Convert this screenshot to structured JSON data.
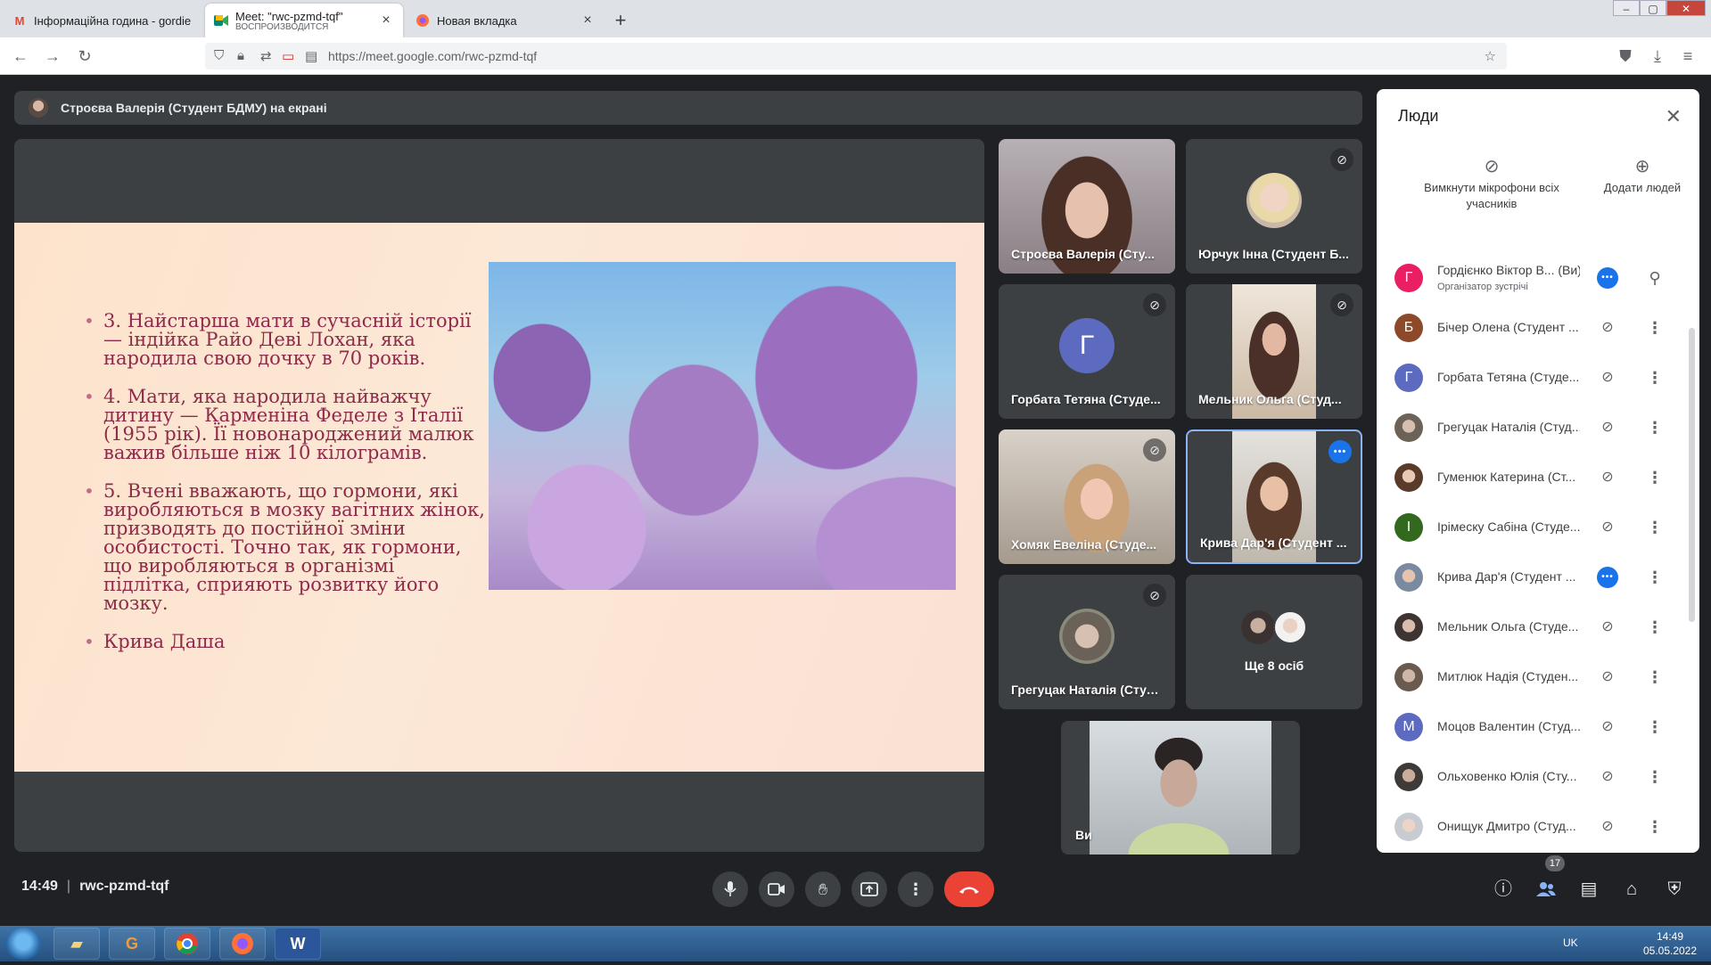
{
  "browser": {
    "tabs": [
      {
        "title": "Інформаційна година - gordie",
        "sub": ""
      },
      {
        "title": "Meet: \"rwc-pzmd-tqf\"",
        "sub": "ВОСПРОИЗВОДИТСЯ"
      },
      {
        "title": "Новая вкладка",
        "sub": ""
      }
    ],
    "url": "https://meet.google.com/rwc-pzmd-tqf"
  },
  "presenting": {
    "text": "Строєва Валерія (Студент БДМУ) на екрані"
  },
  "slide": {
    "items": [
      "3. Найстарша мати в сучасній історії — індійка Райо Деві Лохан, яка народила свою дочку в 70 років.",
      "4. Мати, яка народила найважчу дитину — Карменіна Феделе з Італії (1955 рік). Її новонароджений малюк важив більше ніж 10 кілограмів.",
      "5. Вчені вважають, що гормони, які виробляються в мозку вагітних жінок, призводять до постійної зміни особистості. Точно так, як гормони, що виробляються в організмі підлітка, сприяють розвитку його мозку.",
      "Крива Даша"
    ]
  },
  "tiles": [
    {
      "name": "Строєва Валерія (Сту..."
    },
    {
      "name": "Юрчук Інна (Студент Б..."
    },
    {
      "name": "Горбата Тетяна (Студе...",
      "letter": "Г"
    },
    {
      "name": "Мельник Ольга (Студ..."
    },
    {
      "name": "Хомяк Евеліна (Студе..."
    },
    {
      "name": "Крива Дар'я (Студент ..."
    },
    {
      "name": "Грегуцак Наталія (Студ..."
    },
    {
      "name": "Ще 8 осіб"
    },
    {
      "name": "Ви"
    }
  ],
  "bottom": {
    "time": "14:49",
    "code": "rwc-pzmd-tqf",
    "people_count": "17"
  },
  "panel": {
    "title": "Люди",
    "mute_all": "Вимкнути мікрофони всіх учасників",
    "add_people": "Додати людей",
    "participants": [
      {
        "name": "Гордієнко Віктор В... (Ви)",
        "sub": "Організатор зустрічі",
        "letter": "Г",
        "color": "#e91e63"
      },
      {
        "name": "Бічер Олена (Студент ...",
        "letter": "Б",
        "color": "#8d4a2a"
      },
      {
        "name": "Горбата Тетяна (Студе...",
        "letter": "Г",
        "color": "#5c6bc0"
      },
      {
        "name": "Грегуцак Наталія (Студ...",
        "letter": "",
        "color": "#6d6258"
      },
      {
        "name": "Гуменюк Катерина (Ст...",
        "letter": "",
        "color": "#8a6a4e"
      },
      {
        "name": "Ірімеску Сабіна (Студе...",
        "letter": "І",
        "color": "#33691e"
      },
      {
        "name": "Крива Дар'я (Студент ...",
        "letter": "",
        "color": "#7a8aa0"
      },
      {
        "name": "Мельник Ольга (Студе...",
        "letter": "",
        "color": "#4a4040"
      },
      {
        "name": "Митлюк Надія (Студен...",
        "letter": "",
        "color": "#6a5a50"
      },
      {
        "name": "Моцов Валентин (Студ...",
        "letter": "М",
        "color": "#5c6bc0"
      },
      {
        "name": "Ольховенко Юлія (Сту...",
        "letter": "",
        "color": "#3e3a38"
      },
      {
        "name": "Онищук Дмитро (Студ...",
        "letter": "",
        "color": "#c8ccd2"
      }
    ]
  },
  "taskbar": {
    "lang": "UK",
    "time": "14:49",
    "date": "05.05.2022"
  },
  "colors": {
    "meet_bg": "#202124",
    "tile_bg": "#3c4043",
    "speaking": "#8ab4f8",
    "hangup": "#ea4335",
    "accent": "#1a73e8"
  }
}
